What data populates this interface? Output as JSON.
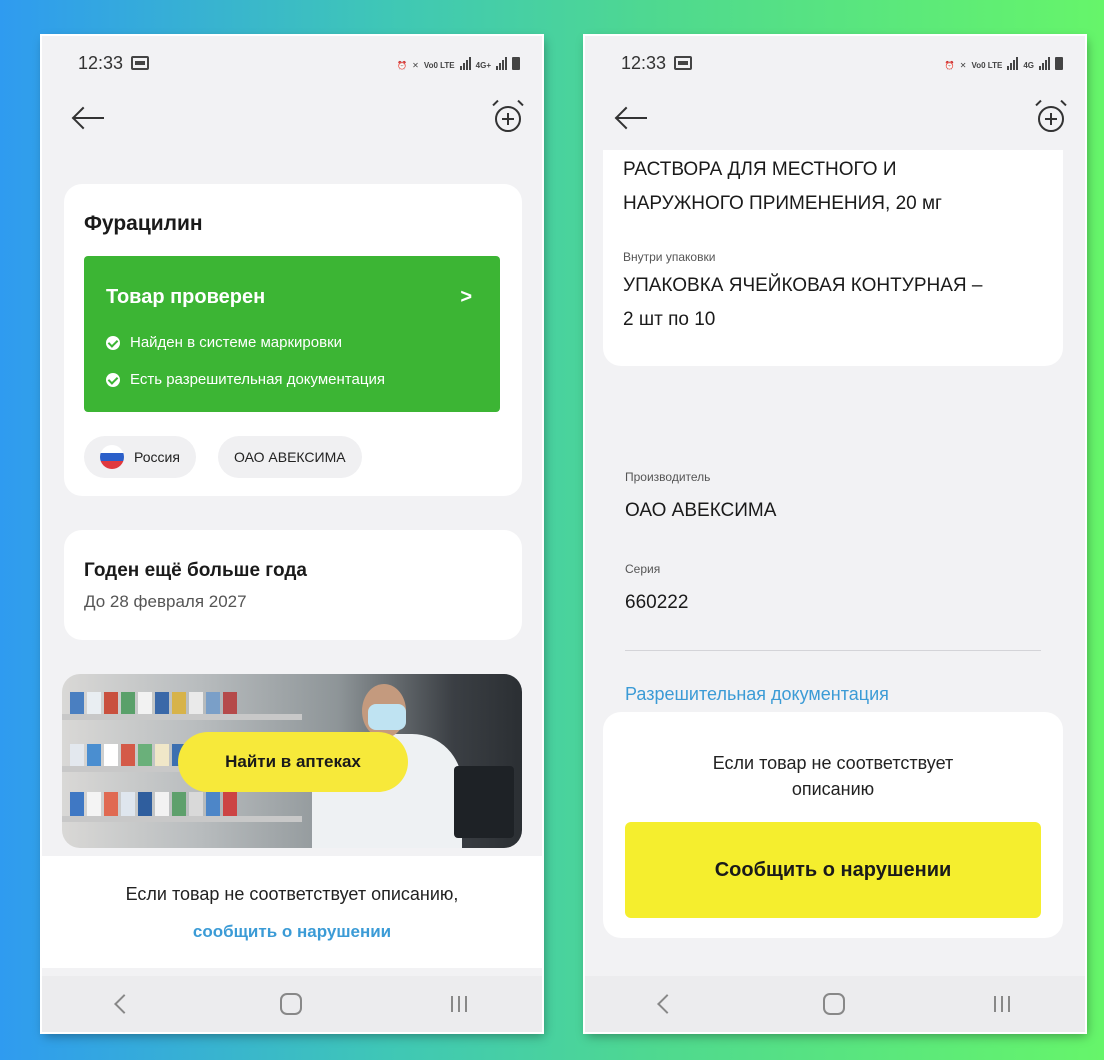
{
  "status_bar": {
    "time": "12:33",
    "volte": "Vo0 LTE",
    "net4g": "4G+",
    "net4g_right": "4G"
  },
  "left": {
    "product_title": "Фурацилин",
    "verified": {
      "title": "Товар проверен",
      "chevron": ">",
      "items": [
        "Найден в системе маркировки",
        "Есть разрешительная документация"
      ]
    },
    "chips": {
      "country": "Россия",
      "manufacturer": "ОАО АВЕКСИМА"
    },
    "expiry": {
      "title": "Годен ещё больше года",
      "date": "До 28 февраля 2027"
    },
    "banner": {
      "button": "Найти в аптеках"
    },
    "bottom": {
      "text": "Если товар не соответствует описанию,",
      "link": "сообщить о нарушении"
    }
  },
  "right": {
    "form_text_line1": "РАСТВОРА ДЛЯ МЕСТНОГО И",
    "form_text_line2": "НАРУЖНОГО ПРИМЕНЕНИЯ, 20 мг",
    "inside_label": "Внутри упаковки",
    "inside_value_line1": "УПАКОВКА ЯЧЕЙКОВАЯ КОНТУРНАЯ –",
    "inside_value_line2": "2 шт по 10",
    "manufacturer_label": "Производитель",
    "manufacturer_value": "ОАО АВЕКСИМА",
    "series_label": "Серия",
    "series_value": "660222",
    "docs_link": "Разрешительная документация",
    "report": {
      "text_line1": "Если товар не соответствует",
      "text_line2": "описанию",
      "button": "Сообщить о нарушении"
    }
  },
  "colors": {
    "green": "#3cb534",
    "yellow": "#f5ee2e",
    "link": "#3b9bd6"
  },
  "icons": {
    "back": "arrow-left-icon",
    "alarm": "alarm-plus-icon"
  }
}
